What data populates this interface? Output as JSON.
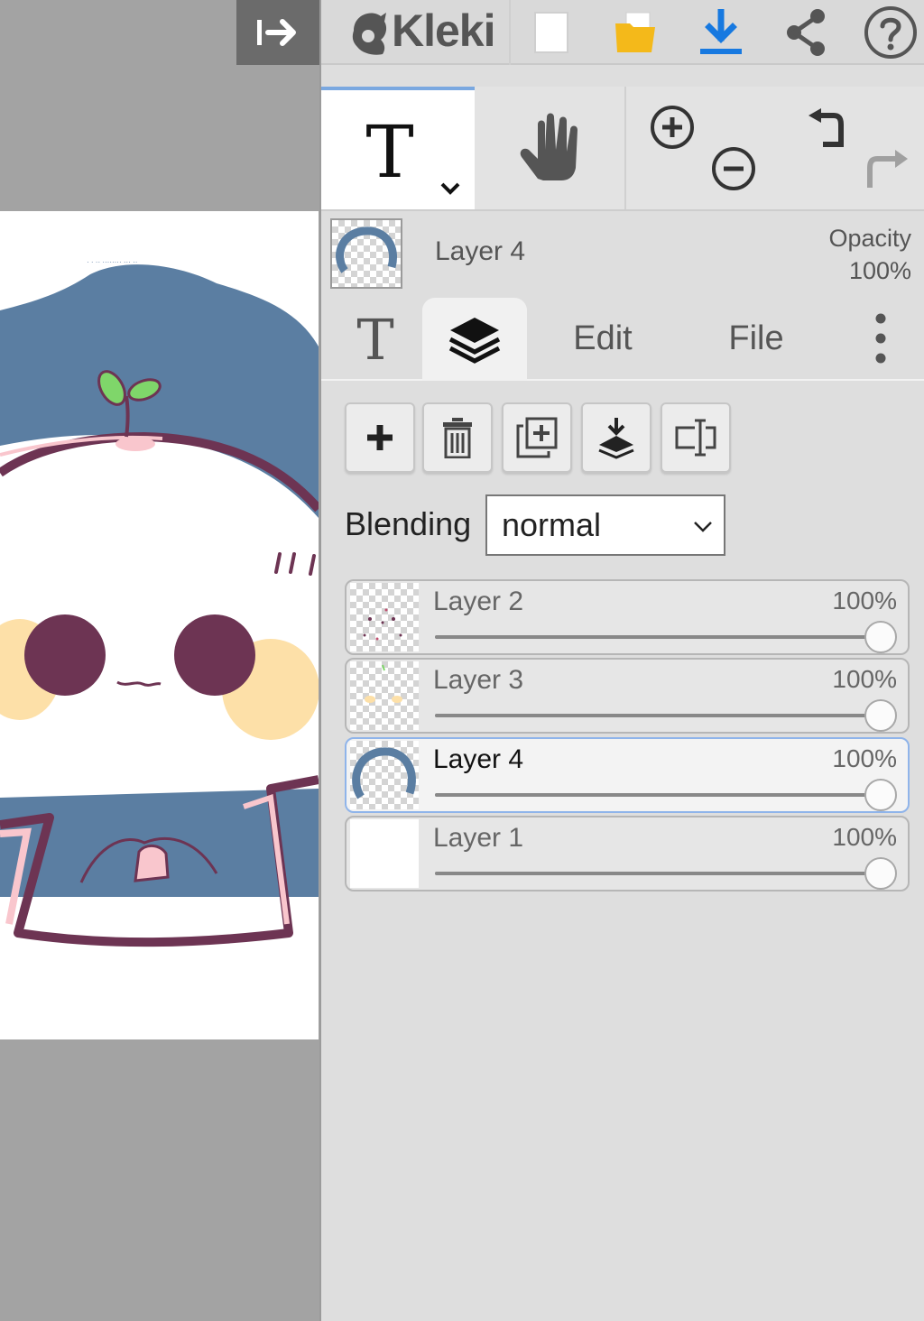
{
  "app": {
    "logo_text": "Kleki"
  },
  "topbar": {
    "icons": [
      "new-image-icon",
      "open-folder-icon",
      "save-download-icon",
      "share-icon",
      "help-icon"
    ],
    "colors": {
      "folder": "#f4b91a",
      "download": "#1779e0",
      "icon": "#555555"
    }
  },
  "tools": {
    "active_tool": "text",
    "items": [
      "text-tool-icon",
      "hand-tool-icon",
      "zoom-in-icon",
      "zoom-out-icon",
      "undo-icon",
      "redo-icon"
    ]
  },
  "current_layer": {
    "name": "Layer 4",
    "opacity_label": "Opacity",
    "opacity_value": "100%"
  },
  "tabs": {
    "edit": "Edit",
    "file": "File",
    "active": "layers"
  },
  "layer_actions": [
    "add-layer",
    "delete-layer",
    "duplicate-layer",
    "merge-layer-down",
    "rename-layer"
  ],
  "blending": {
    "label": "Blending",
    "value": "normal"
  },
  "layers": [
    {
      "name": "Layer 2",
      "opacity": "100%",
      "level": 1.0,
      "active": false
    },
    {
      "name": "Layer 3",
      "opacity": "100%",
      "level": 1.0,
      "active": false
    },
    {
      "name": "Layer 4",
      "opacity": "100%",
      "level": 1.0,
      "active": true
    },
    {
      "name": "Layer 1",
      "opacity": "100%",
      "level": 1.0,
      "active": false
    }
  ],
  "canvas": {
    "colors": {
      "hair": "#5b7ea2",
      "outline": "#6d3453",
      "sprout": "#7fd66a",
      "cheek": "#fde0a8",
      "blush": "#f9c6cd"
    }
  }
}
